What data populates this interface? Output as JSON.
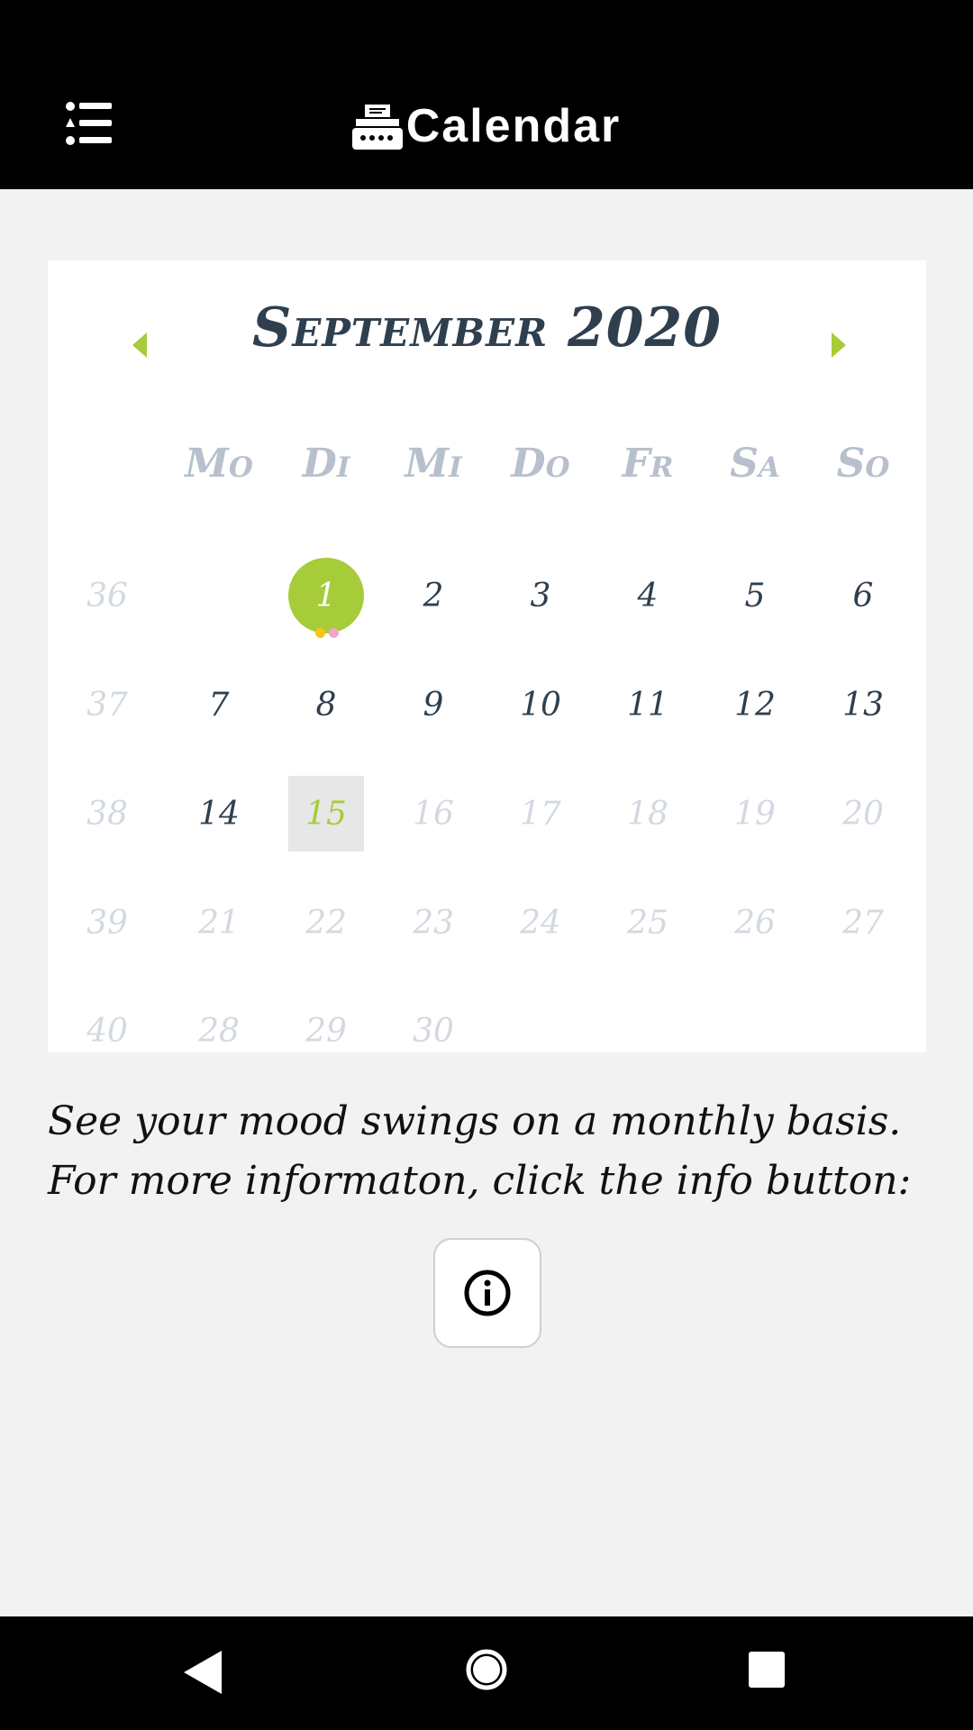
{
  "appbar": {
    "title": "Calendar",
    "menu_icon": "list-icon",
    "title_icon": "typewriter-icon"
  },
  "calendar": {
    "month_title": "September 2020",
    "prev_icon": "caret-left-icon",
    "next_icon": "caret-right-icon",
    "weekdays": [
      "Mo",
      "Di",
      "Mi",
      "Do",
      "Fr",
      "Sa",
      "So"
    ],
    "weeks": [
      {
        "week": "36",
        "days": [
          "",
          "1",
          "2",
          "3",
          "4",
          "5",
          "6"
        ]
      },
      {
        "week": "37",
        "days": [
          "7",
          "8",
          "9",
          "10",
          "11",
          "12",
          "13"
        ]
      },
      {
        "week": "38",
        "days": [
          "14",
          "15",
          "16",
          "17",
          "18",
          "19",
          "20"
        ]
      },
      {
        "week": "39",
        "days": [
          "21",
          "22",
          "23",
          "24",
          "25",
          "26",
          "27"
        ]
      },
      {
        "week": "40",
        "days": [
          "28",
          "29",
          "30",
          "",
          "",
          "",
          ""
        ]
      }
    ],
    "selected_day": "1",
    "today_day": "15",
    "mood_dot_colors": [
      "#f5c518",
      "#f0a6c8"
    ],
    "accent_color": "#a6cc3a",
    "text_color": "#2f3f4e",
    "muted_color": "#d3d9e0"
  },
  "description": "See your mood swings on a monthly basis. For more informaton, click the info button:",
  "info_button": {
    "icon": "info-circle-icon"
  },
  "system_nav": {
    "back_icon": "back-triangle-icon",
    "home_icon": "home-circle-icon",
    "recent_icon": "recent-square-icon"
  }
}
